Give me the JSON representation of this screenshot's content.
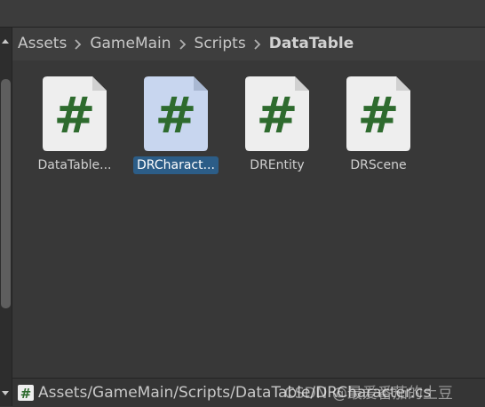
{
  "breadcrumb": {
    "items": [
      "Assets",
      "GameMain",
      "Scripts",
      "DataTable"
    ]
  },
  "assets": [
    {
      "label": "DataTable...",
      "selected": false
    },
    {
      "label": "DRCharact...",
      "selected": true
    },
    {
      "label": "DREntity",
      "selected": false
    },
    {
      "label": "DRScene",
      "selected": false
    }
  ],
  "statusbar": {
    "path": "Assets/GameMain/Scripts/DataTable/DRCharacter.cs"
  },
  "watermark": "CSDN @最爱番茄的土豆",
  "colors": {
    "hash_green": "#2e6b2e",
    "file_bg": "#eeeeee",
    "file_bg_selected": "#c8d6ef",
    "selection": "#2c5d87"
  }
}
